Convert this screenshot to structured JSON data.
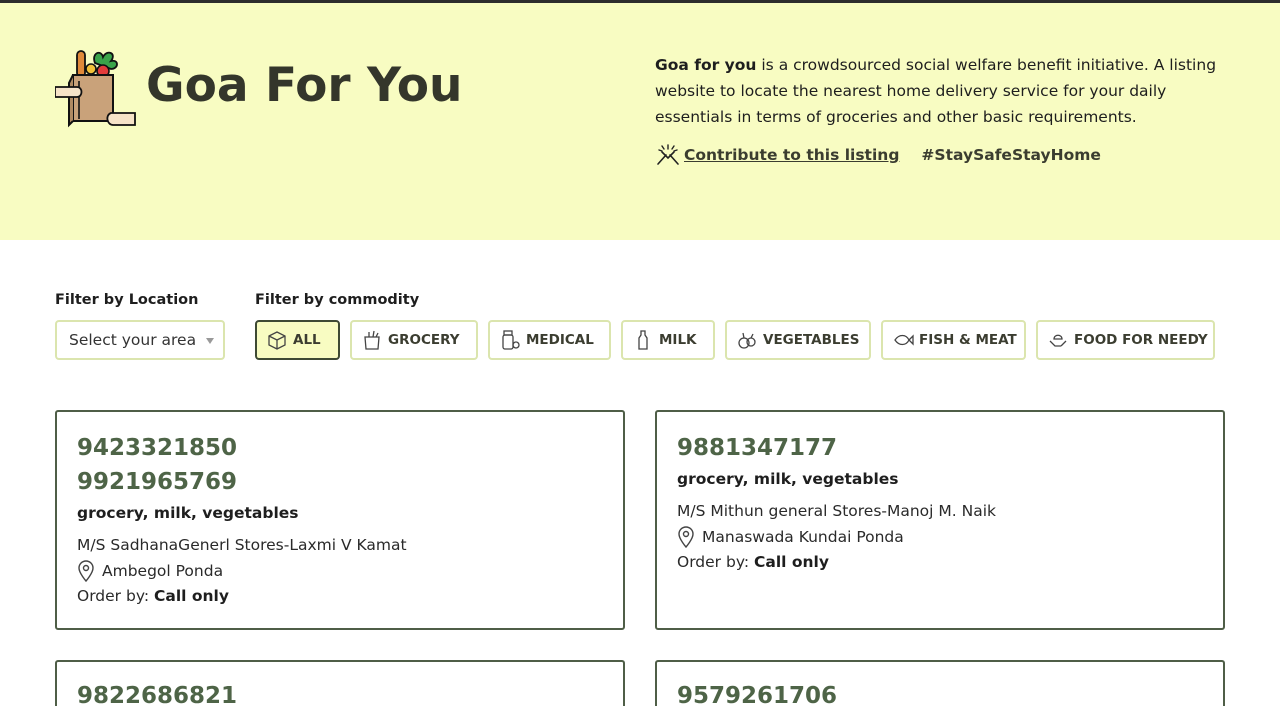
{
  "header": {
    "title": "Goa For You",
    "description_bold": "Goa for you",
    "description_rest": " is a crowdsourced social welfare benefit initiative. A listing website to locate the nearest home delivery service for your daily essentials in terms of groceries and other basic requirements.",
    "contribute_label": "Contribute to this listing",
    "hashtag": "#StaySafeStayHome"
  },
  "filters": {
    "location_label": "Filter by Location",
    "location_placeholder": "Select your area",
    "commodity_label": "Filter by commodity",
    "commodities": [
      {
        "label": "ALL",
        "icon": "box-icon",
        "active": true
      },
      {
        "label": "GROCERY",
        "icon": "grocery-icon",
        "active": false
      },
      {
        "label": "MEDICAL",
        "icon": "medical-icon",
        "active": false
      },
      {
        "label": "MILK",
        "icon": "milk-bottle-icon",
        "active": false
      },
      {
        "label": "VEGETABLES",
        "icon": "vegetables-icon",
        "active": false
      },
      {
        "label": "FISH & MEAT",
        "icon": "fish-icon",
        "active": false
      },
      {
        "label": "FOOD FOR NEEDY",
        "icon": "food-needy-icon",
        "active": false
      }
    ]
  },
  "listings": [
    {
      "phones": [
        "9423321850",
        "9921965769"
      ],
      "categories": "grocery, milk, vegetables",
      "store": "M/S SadhanaGenerl Stores-Laxmi V Kamat",
      "address": "Ambegol Ponda",
      "order_prefix": "Order by: ",
      "order_method": "Call only"
    },
    {
      "phones": [
        "9881347177"
      ],
      "categories": "grocery, milk, vegetables",
      "store": "M/S Mithun general Stores-Manoj M. Naik",
      "address": "Manaswada Kundai Ponda",
      "order_prefix": "Order by: ",
      "order_method": "Call only"
    },
    {
      "phones": [
        "9822686821"
      ]
    },
    {
      "phones": [
        "9579261706"
      ]
    }
  ],
  "colors": {
    "hero_bg": "#f8fcc2",
    "accent_green": "#4e6447",
    "chip_border": "#dbe5ae",
    "title": "#34362b"
  }
}
